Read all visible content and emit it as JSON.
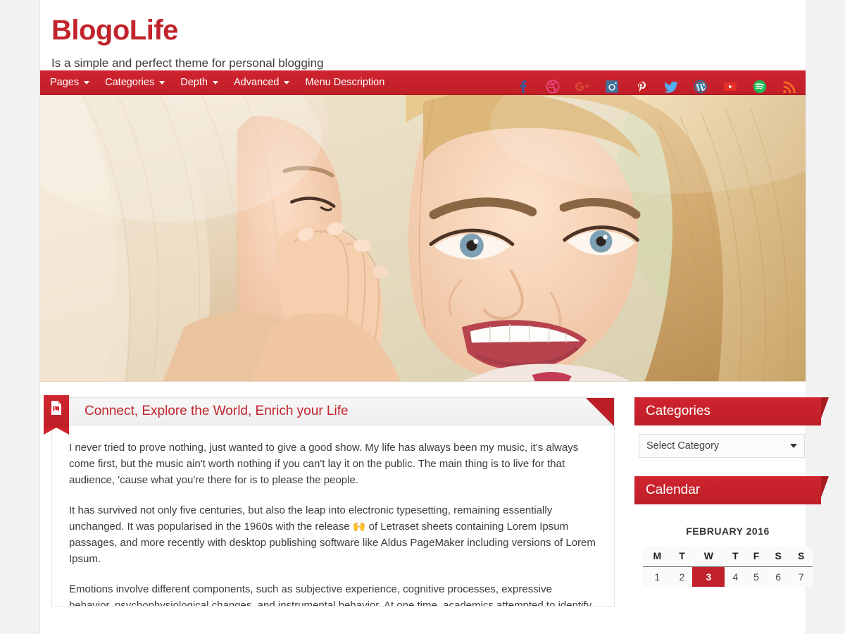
{
  "site": {
    "title": "BlogoLife",
    "description": "Is a simple and perfect theme for personal blogging",
    "brand_color": "#c1242c",
    "accent_color": "#cf2430"
  },
  "social": [
    {
      "name": "facebook-icon",
      "label": "Facebook",
      "color": "#3b5998"
    },
    {
      "name": "dribbble-icon",
      "label": "Dribbble",
      "color": "#ea4c89"
    },
    {
      "name": "google-plus-icon",
      "label": "Google Plus",
      "color": "#dd4b39"
    },
    {
      "name": "instagram-icon",
      "label": "Instagram",
      "color": "#3f729b"
    },
    {
      "name": "pinterest-icon",
      "label": "Pinterest",
      "color": "#cb2027"
    },
    {
      "name": "twitter-icon",
      "label": "Twitter",
      "color": "#55acee"
    },
    {
      "name": "wordpress-icon",
      "label": "WordPress",
      "color": "#21759b"
    },
    {
      "name": "youtube-icon",
      "label": "YouTube",
      "color": "#e52d27"
    },
    {
      "name": "spotify-icon",
      "label": "Spotify",
      "color": "#1db954"
    },
    {
      "name": "rss-icon",
      "label": "RSS",
      "color": "#f26522"
    }
  ],
  "nav": {
    "items": [
      {
        "label": "Pages",
        "has_dropdown": true
      },
      {
        "label": "Categories",
        "has_dropdown": true
      },
      {
        "label": "Depth",
        "has_dropdown": true
      },
      {
        "label": "Advanced",
        "has_dropdown": true
      },
      {
        "label": "Menu Description",
        "has_dropdown": false
      }
    ]
  },
  "hero": {
    "alt": "Two blonde women, one whispering a secret into the other's ear while she smiles"
  },
  "post": {
    "icon": "image-file-icon",
    "title": "Connect, Explore the World, Enrich your Life",
    "paragraphs": [
      "I never tried to prove nothing, just wanted to give a good show. My life has always been my music, it's always come first, but the music ain't worth nothing if you can't lay it on the public. The main thing is to live for that audience, 'cause what you're there for is to please the people.",
      "It has survived not only five centuries, but also the leap into electronic typesetting, remaining essentially unchanged. It was popularised in the 1960s with the release 🙌 of Letraset sheets containing Lorem Ipsum passages, and more recently with desktop publishing software like Aldus PageMaker including versions of Lorem Ipsum.",
      "Emotions involve different components, such as subjective experience, cognitive processes, expressive behavior, psychophysiological changes, and instrumental behavior. At one time, academics attempted to identify the"
    ]
  },
  "sidebar": {
    "widgets": [
      {
        "name": "categories-widget",
        "title": "Categories",
        "type": "select",
        "select": {
          "selected": "Select Category",
          "caret": "chevron-down-icon"
        }
      },
      {
        "name": "calendar-widget",
        "title": "Calendar",
        "type": "calendar",
        "calendar": {
          "caption": "FEBRUARY 2016",
          "weekdays": [
            "M",
            "T",
            "W",
            "T",
            "F",
            "S",
            "S"
          ],
          "weeks": [
            [
              "1",
              "2",
              "3",
              "4",
              "5",
              "6",
              "7"
            ]
          ],
          "today": "3"
        }
      }
    ]
  }
}
